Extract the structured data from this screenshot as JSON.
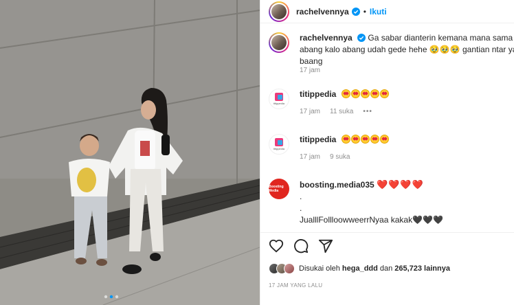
{
  "header": {
    "username": "rachelvennya",
    "separator": "•",
    "follow_label": "Ikuti"
  },
  "caption": {
    "username": "rachelvennya",
    "text": "Ga sabar dianterin kemana mana sama abang kalo abang udah gede hehe 🥹🥹🥹 gantian ntar ya baang",
    "time": "17 jam"
  },
  "comments": [
    {
      "username": "titippedia",
      "logo_text": "titippedia",
      "emoji_count": 5,
      "emoji": "😍",
      "time": "17 jam",
      "likes": "11 suka",
      "more": "•••"
    },
    {
      "username": "titippedia",
      "logo_text": "titippedia",
      "emoji_count": 5,
      "emoji": "😍",
      "time": "17 jam",
      "likes": "9 suka"
    },
    {
      "username": "boosting.media035",
      "logo_text": "Boosting Media",
      "hearts": "❤️❤️❤️❤️",
      "lines": [
        ".",
        ".",
        "JualllFollloowweerrNyaa kakak🖤🖤🖤"
      ]
    }
  ],
  "actions": {
    "icons": [
      "heart-icon",
      "comment-icon",
      "share-icon"
    ]
  },
  "likes": {
    "prefix": "Disukai oleh",
    "user": "hega_ddd",
    "conj": "dan",
    "count": "265,723 lainnya"
  },
  "timestamp": "17 JAM YANG LALU",
  "colors": {
    "follow": "#0095f6",
    "muted": "#8e8e8e",
    "heart": "#e0243c"
  }
}
